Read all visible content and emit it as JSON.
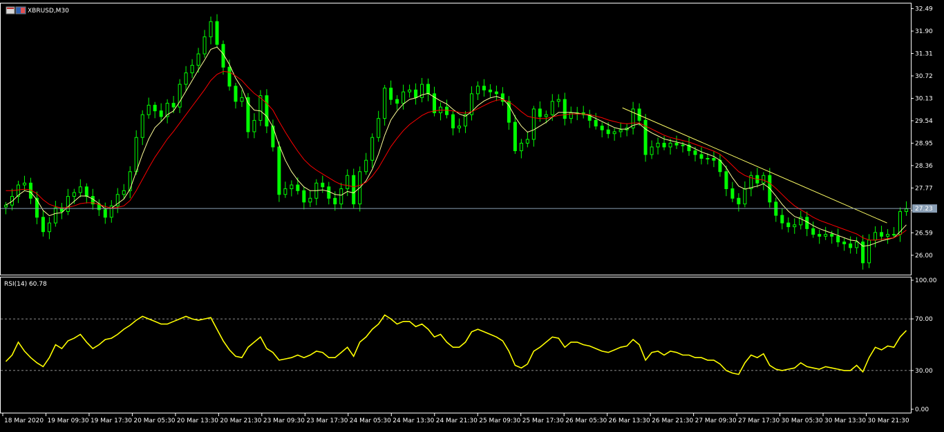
{
  "chart_window": {
    "symbol_title": "XBRUSD,M30",
    "current_price_label": "27.23"
  },
  "colors": {
    "background": "#000000",
    "frame": "#ffffff",
    "candle_up": "#00ff00",
    "candle_down": "#00ff00",
    "ma_fast": "#ffff99",
    "ma_slow": "#ff0000",
    "trendline": "#ffff66",
    "rsi_line": "#ffff00",
    "price_line": "#8a9fb5",
    "levels": "#c0c0c0"
  },
  "chart_data": [
    {
      "type": "line",
      "subtype": "candlestick",
      "title": "XBRUSD,M30",
      "ylim": [
        25.58,
        32.5
      ],
      "y_ticks": [
        "32.49",
        "31.90",
        "31.31",
        "30.72",
        "30.13",
        "29.54",
        "28.95",
        "28.36",
        "27.77",
        "27.18",
        "26.59",
        "26.00"
      ],
      "current_price": 27.23,
      "x_time_labels": [
        "18 Mar 2020",
        "19 Mar 09:30",
        "19 Mar 17:30",
        "20 Mar 05:30",
        "20 Mar 13:30",
        "20 Mar 21:30",
        "23 Mar 09:30",
        "23 Mar 17:30",
        "24 Mar 05:30",
        "24 Mar 13:30",
        "24 Mar 21:30",
        "25 Mar 09:30",
        "25 Mar 17:30",
        "26 Mar 05:30",
        "26 Mar 13:30",
        "26 Mar 21:30",
        "27 Mar 09:30",
        "27 Mar 17:30",
        "30 Mar 05:30",
        "30 Mar 13:30",
        "30 Mar 21:30"
      ],
      "close_series": [
        27.32,
        27.55,
        27.85,
        27.9,
        27.5,
        27.0,
        26.62,
        26.85,
        27.25,
        27.15,
        27.55,
        27.65,
        27.8,
        27.55,
        27.35,
        27.2,
        27.0,
        27.3,
        27.6,
        27.7,
        28.2,
        29.1,
        29.7,
        29.95,
        29.8,
        29.65,
        30.0,
        29.9,
        30.5,
        30.8,
        31.0,
        31.3,
        31.75,
        32.15,
        31.55,
        30.95,
        30.45,
        30.05,
        30.15,
        29.25,
        29.55,
        30.2,
        29.4,
        28.85,
        27.6,
        27.75,
        27.85,
        27.7,
        27.4,
        27.5,
        27.9,
        27.8,
        27.5,
        27.35,
        27.75,
        28.1,
        27.35,
        28.2,
        28.5,
        29.1,
        29.6,
        30.4,
        30.1,
        30.0,
        30.3,
        30.35,
        30.15,
        30.5,
        30.25,
        29.75,
        29.9,
        29.7,
        29.35,
        29.4,
        29.7,
        30.25,
        30.45,
        30.35,
        30.3,
        30.25,
        30.05,
        29.5,
        28.75,
        28.95,
        29.05,
        29.85,
        29.65,
        29.7,
        30.05,
        30.1,
        29.6,
        29.75,
        29.75,
        29.7,
        29.55,
        29.4,
        29.3,
        29.2,
        29.25,
        29.3,
        29.35,
        29.85,
        29.55,
        28.65,
        28.85,
        28.95,
        28.85,
        28.95,
        28.9,
        28.9,
        28.75,
        28.65,
        28.55,
        28.55,
        28.5,
        28.2,
        27.75,
        27.5,
        27.35,
        27.75,
        28.1,
        27.9,
        28.1,
        27.4,
        27.05,
        26.85,
        26.75,
        26.8,
        27.0,
        26.7,
        26.55,
        26.5,
        26.55,
        26.5,
        26.35,
        26.3,
        26.2,
        26.35,
        25.8,
        26.4,
        26.6,
        26.5,
        26.55,
        26.55,
        27.15,
        27.22
      ],
      "series": [
        {
          "name": "",
          "color": "#ffff99",
          "values": [
            27.32,
            27.42,
            27.58,
            27.7,
            27.66,
            27.46,
            27.18,
            27.04,
            27.1,
            27.12,
            27.28,
            27.42,
            27.56,
            27.56,
            27.48,
            27.36,
            27.22,
            27.24,
            27.36,
            27.48,
            27.74,
            28.2,
            28.66,
            29.06,
            29.36,
            29.52,
            29.7,
            29.8,
            30.04,
            30.32,
            30.6,
            30.88,
            31.14,
            31.42,
            31.48,
            31.3,
            31.02,
            30.66,
            30.4,
            30.0,
            29.82,
            29.8,
            29.66,
            29.38,
            28.9,
            28.5,
            28.2,
            27.98,
            27.8,
            27.7,
            27.7,
            27.72,
            27.68,
            27.6,
            27.58,
            27.68,
            27.64,
            27.78,
            27.96,
            28.26,
            28.66,
            29.16,
            29.56,
            29.8,
            29.98,
            30.1,
            30.14,
            30.22,
            30.26,
            30.16,
            30.06,
            29.98,
            29.84,
            29.72,
            29.66,
            29.78,
            29.94,
            30.06,
            30.14,
            30.18,
            30.12,
            29.94,
            29.64,
            29.4,
            29.24,
            29.3,
            29.4,
            29.5,
            29.64,
            29.76,
            29.76,
            29.76,
            29.74,
            29.72,
            29.68,
            29.6,
            29.52,
            29.44,
            29.36,
            29.32,
            29.32,
            29.42,
            29.46,
            29.32,
            29.22,
            29.14,
            29.06,
            29.02,
            28.98,
            28.94,
            28.88,
            28.8,
            28.72,
            28.66,
            28.6,
            28.5,
            28.3,
            28.04,
            27.82,
            27.74,
            27.78,
            27.82,
            27.88,
            27.76,
            27.56,
            27.34,
            27.16,
            27.02,
            26.96,
            26.88,
            26.78,
            26.7,
            26.64,
            26.58,
            26.52,
            26.46,
            26.4,
            26.38,
            26.24,
            26.26,
            26.32,
            26.38,
            26.42,
            26.46,
            26.62,
            26.8
          ]
        },
        {
          "name": "",
          "color": "#ff0000",
          "values": [
            27.7,
            27.7,
            27.72,
            27.74,
            27.72,
            27.62,
            27.46,
            27.34,
            27.28,
            27.24,
            27.26,
            27.3,
            27.36,
            27.38,
            27.38,
            27.34,
            27.28,
            27.24,
            27.26,
            27.3,
            27.44,
            27.7,
            28.0,
            28.3,
            28.58,
            28.82,
            29.06,
            29.26,
            29.48,
            29.7,
            29.92,
            30.14,
            30.36,
            30.6,
            30.76,
            30.84,
            30.82,
            30.72,
            30.6,
            30.42,
            30.26,
            30.14,
            30.0,
            29.82,
            29.52,
            29.24,
            28.98,
            28.74,
            28.52,
            28.36,
            28.24,
            28.14,
            28.04,
            27.94,
            27.86,
            27.84,
            27.8,
            27.84,
            27.92,
            28.08,
            28.3,
            28.58,
            28.86,
            29.08,
            29.28,
            29.44,
            29.56,
            29.68,
            29.76,
            29.8,
            29.82,
            29.82,
            29.8,
            29.76,
            29.74,
            29.78,
            29.86,
            29.94,
            30.02,
            30.08,
            30.1,
            30.04,
            29.92,
            29.78,
            29.66,
            29.62,
            29.6,
            29.6,
            29.64,
            29.68,
            29.7,
            29.72,
            29.72,
            29.72,
            29.7,
            29.66,
            29.62,
            29.56,
            29.52,
            29.48,
            29.46,
            29.48,
            29.48,
            29.4,
            29.32,
            29.24,
            29.16,
            29.1,
            29.06,
            29.02,
            28.98,
            28.92,
            28.86,
            28.8,
            28.74,
            28.66,
            28.52,
            28.36,
            28.2,
            28.1,
            28.04,
            28.0,
            27.98,
            27.9,
            27.76,
            27.6,
            27.44,
            27.3,
            27.2,
            27.1,
            27.0,
            26.92,
            26.86,
            26.8,
            26.74,
            26.68,
            26.62,
            26.56,
            26.46,
            26.4,
            26.4,
            26.42,
            26.44,
            26.46,
            26.54,
            26.66
          ]
        }
      ],
      "trendline": {
        "from": {
          "x": "26 Mar 13:30",
          "y": 29.88
        },
        "to": {
          "x": "30 Mar 21:30",
          "y": 26.85
        }
      }
    },
    {
      "type": "line",
      "title": "RSI(14) 60.78",
      "indicator_label": "RSI(14) 60.78",
      "ylim": [
        0,
        100
      ],
      "y_ticks": [
        "100.00",
        "70.00",
        "30.00",
        "0.00"
      ],
      "levels": [
        70,
        30
      ],
      "series": [
        {
          "name": "RSI(14)",
          "color": "#ffff00",
          "values": [
            37,
            42,
            52,
            45,
            40,
            36,
            33,
            40,
            50,
            47,
            53,
            55,
            58,
            52,
            47,
            50,
            54,
            55,
            58,
            62,
            65,
            69,
            72,
            70,
            68,
            66,
            66,
            68,
            70,
            72,
            70,
            69,
            70,
            71,
            62,
            53,
            46,
            41,
            40,
            48,
            52,
            56,
            47,
            44,
            38,
            39,
            40,
            42,
            40,
            42,
            45,
            44,
            40,
            40,
            44,
            48,
            41,
            52,
            56,
            62,
            66,
            73,
            70,
            66,
            68,
            68,
            64,
            66,
            62,
            56,
            58,
            52,
            48,
            48,
            52,
            60,
            62,
            60,
            58,
            56,
            53,
            45,
            34,
            32,
            35,
            45,
            48,
            52,
            56,
            55,
            48,
            52,
            52,
            50,
            49,
            47,
            45,
            44,
            46,
            48,
            49,
            54,
            50,
            38,
            44,
            45,
            42,
            45,
            44,
            42,
            42,
            40,
            40,
            38,
            38,
            35,
            30,
            28,
            27,
            36,
            42,
            40,
            43,
            34,
            31,
            30,
            31,
            32,
            36,
            33,
            32,
            31,
            33,
            32,
            31,
            30,
            30,
            34,
            29,
            40,
            48,
            46,
            49,
            48,
            56,
            61
          ]
        }
      ]
    }
  ]
}
